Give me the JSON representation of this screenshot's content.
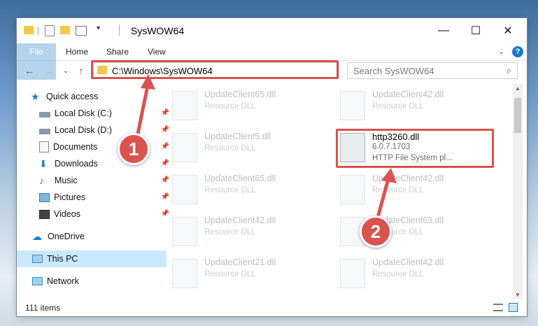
{
  "window": {
    "title": "SysWOW64",
    "minimize_glyph": "—",
    "maximize_glyph": "☐",
    "close_glyph": "✕"
  },
  "ribbon": {
    "tabs": [
      "File",
      "Home",
      "Share",
      "View"
    ]
  },
  "nav": {
    "address": "C:\\Windows\\SysWOW64",
    "search_placeholder": "Search SysWOW64"
  },
  "sidebar": {
    "items": [
      {
        "label": "Quick access",
        "icon": "star-icon",
        "pinned": false
      },
      {
        "label": "Local Disk (C:)",
        "icon": "drive-icon",
        "pinned": true
      },
      {
        "label": "Local Disk (D:)",
        "icon": "drive-icon",
        "pinned": true
      },
      {
        "label": "Documents",
        "icon": "documents-icon",
        "pinned": true
      },
      {
        "label": "Downloads",
        "icon": "download-icon",
        "pinned": true
      },
      {
        "label": "Music",
        "icon": "music-icon",
        "pinned": true
      },
      {
        "label": "Pictures",
        "icon": "pictures-icon",
        "pinned": true
      },
      {
        "label": "Videos",
        "icon": "videos-icon",
        "pinned": true
      },
      {
        "label": "OneDrive",
        "icon": "cloud-icon",
        "pinned": false
      },
      {
        "label": "This PC",
        "icon": "computer-icon",
        "pinned": false,
        "selected": true
      },
      {
        "label": "Network",
        "icon": "network-icon",
        "pinned": false
      }
    ]
  },
  "files": [
    {
      "name": "UpdateClient65.dll",
      "type": "Resource DLL"
    },
    {
      "name": "UpdateClient42.dll",
      "type": "Resource DLL"
    },
    {
      "name": "UpdateClient5.dll",
      "type": "Resource DLL"
    },
    {
      "name": "http3260.dll",
      "version": "6.0.7.1703",
      "type": "HTTP File System pl..."
    },
    {
      "name": "UpdateClient65.dll",
      "type": "Resource DLL"
    },
    {
      "name": "UpdateClient42.dll",
      "type": "Resource DLL"
    },
    {
      "name": "UpdateClient42.dll",
      "type": "Resource DLL"
    },
    {
      "name": "UpdateClient63.dll",
      "type": "Resource DLL"
    },
    {
      "name": "UpdateClient21.dll",
      "type": "Resource DLL"
    },
    {
      "name": "UpdateClient42.dll",
      "type": "Resource DLL"
    }
  ],
  "status": {
    "item_count": "111 items"
  },
  "callouts": {
    "one": "1",
    "two": "2"
  },
  "colors": {
    "accent": "#1979ca",
    "highlight": "#d9534f"
  }
}
